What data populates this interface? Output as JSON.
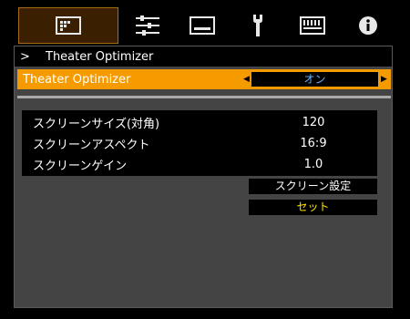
{
  "tabs": [
    {
      "icon": "picture-adjust-icon",
      "active": true
    },
    {
      "icon": "settings-list-icon",
      "active": false
    },
    {
      "icon": "display-icon",
      "active": false
    },
    {
      "icon": "wrench-icon",
      "active": false
    },
    {
      "icon": "keyboard-icon",
      "active": false
    },
    {
      "icon": "info-icon",
      "active": false
    }
  ],
  "breadcrumb": {
    "marker": ">",
    "title": "Theater Optimizer"
  },
  "option": {
    "label": "Theater Optimizer",
    "value": "オン"
  },
  "info": {
    "rows": [
      {
        "key": "スクリーンサイズ(対角)",
        "value": "120"
      },
      {
        "key": "スクリーンアスペクト",
        "value": "16:9"
      },
      {
        "key": "スクリーンゲイン",
        "value": "1.0"
      }
    ]
  },
  "buttons": {
    "screen_settings": "スクリーン設定",
    "set": "セット"
  },
  "colors": {
    "accent": "#f59b00",
    "value_blue": "#6ab4ff",
    "set_yellow": "#ffe200",
    "panel": "#444444"
  }
}
